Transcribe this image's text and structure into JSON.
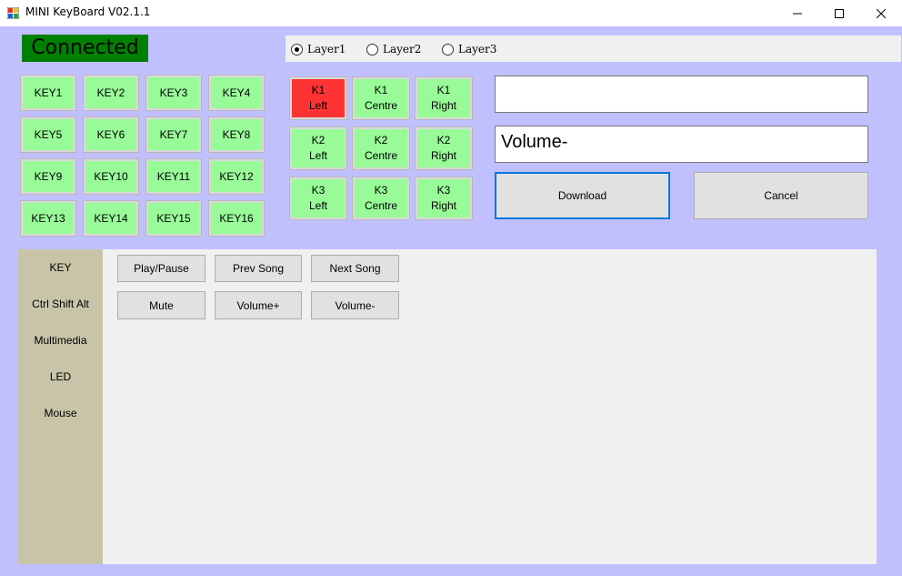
{
  "window": {
    "title": "MINI KeyBoard V02.1.1"
  },
  "status": {
    "label": "Connected"
  },
  "layers": {
    "options": [
      "Layer1",
      "Layer2",
      "Layer3"
    ],
    "selected": "Layer1"
  },
  "keys": [
    "KEY1",
    "KEY2",
    "KEY3",
    "KEY4",
    "KEY5",
    "KEY6",
    "KEY7",
    "KEY8",
    "KEY9",
    "KEY10",
    "KEY11",
    "KEY12",
    "KEY13",
    "KEY14",
    "KEY15",
    "KEY16"
  ],
  "knobs": [
    {
      "top": "K1",
      "bottom": "Left",
      "active": true
    },
    {
      "top": "K1",
      "bottom": "Centre",
      "active": false
    },
    {
      "top": "K1",
      "bottom": "Right",
      "active": false
    },
    {
      "top": "K2",
      "bottom": "Left",
      "active": false
    },
    {
      "top": "K2",
      "bottom": "Centre",
      "active": false
    },
    {
      "top": "K2",
      "bottom": "Right",
      "active": false
    },
    {
      "top": "K3",
      "bottom": "Left",
      "active": false
    },
    {
      "top": "K3",
      "bottom": "Centre",
      "active": false
    },
    {
      "top": "K3",
      "bottom": "Right",
      "active": false
    }
  ],
  "fields": {
    "first_value": "",
    "second_value": "Volume-"
  },
  "actions": {
    "download": "Download",
    "cancel": "Cancel"
  },
  "sidebar": {
    "items": [
      "KEY",
      "Ctrl Shift Alt",
      "Multimedia",
      "LED",
      "Mouse"
    ]
  },
  "multimedia": {
    "buttons": [
      "Play/Pause",
      "Prev Song",
      "Next Song",
      "Mute",
      "Volume+",
      "Volume-"
    ]
  },
  "colors": {
    "key_green": "#98fb98",
    "active_red": "#ff3333",
    "status_green": "#008000",
    "background": "#c0c0ff"
  }
}
